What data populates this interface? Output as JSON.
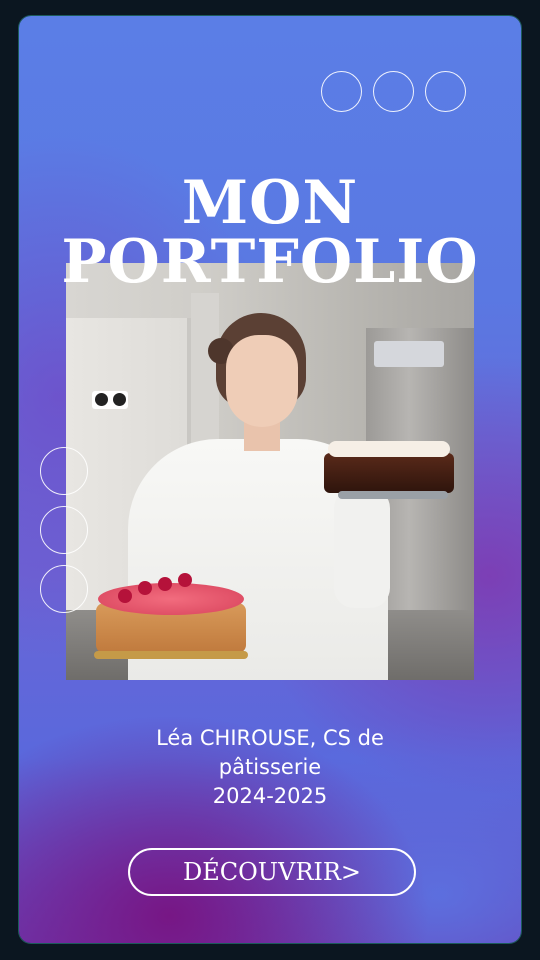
{
  "hero": {
    "title_line1": "MON",
    "title_line2": "PORTFOLIO",
    "photo_description": "Pastry chef in white jacket holding two cakes"
  },
  "info": {
    "line1": "Léa CHIROUSE, CS de",
    "line2": "pâtisserie",
    "line3": "2024-2025"
  },
  "cta": {
    "label": "DÉCOUVRIR>"
  },
  "colors": {
    "background": "#0b1620",
    "card_gradient_start": "#5b7ee6",
    "card_gradient_end": "#6a3fb5",
    "accent_purple": "#7a148a",
    "text": "#ffffff"
  },
  "decorations": {
    "top_rings": 3,
    "left_rings": 3
  }
}
